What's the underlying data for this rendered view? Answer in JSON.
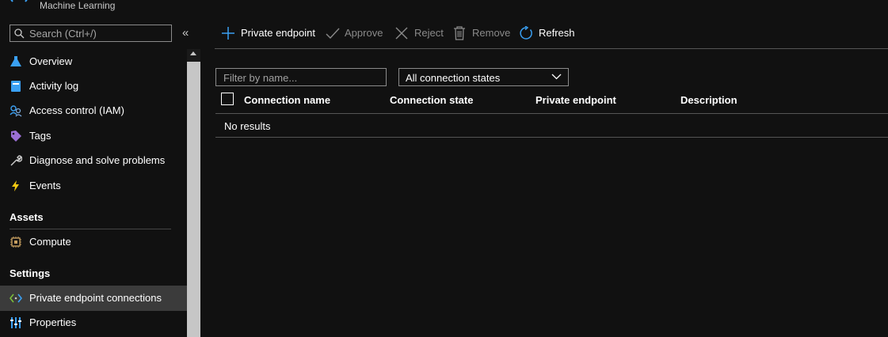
{
  "header": {
    "service_subtitle": "Machine Learning"
  },
  "search": {
    "placeholder": "Search (Ctrl+/)"
  },
  "sidebar": {
    "collapse_glyph": "«",
    "items": [
      {
        "label": "Overview",
        "icon": "overview-icon"
      },
      {
        "label": "Activity log",
        "icon": "activity-log-icon"
      },
      {
        "label": "Access control (IAM)",
        "icon": "iam-icon"
      },
      {
        "label": "Tags",
        "icon": "tag-icon"
      },
      {
        "label": "Diagnose and solve problems",
        "icon": "wrench-icon"
      },
      {
        "label": "Events",
        "icon": "lightning-icon"
      }
    ],
    "sections": [
      {
        "title": "Assets",
        "items": [
          {
            "label": "Compute",
            "icon": "compute-chip-icon"
          }
        ]
      },
      {
        "title": "Settings",
        "items": [
          {
            "label": "Private endpoint connections",
            "icon": "private-endpoint-icon",
            "active": true
          },
          {
            "label": "Properties",
            "icon": "properties-icon"
          }
        ]
      }
    ]
  },
  "toolbar": {
    "private_endpoint": "Private endpoint",
    "approve": "Approve",
    "reject": "Reject",
    "remove": "Remove",
    "refresh": "Refresh"
  },
  "filters": {
    "name_placeholder": "Filter by name...",
    "state_selected": "All connection states"
  },
  "table": {
    "columns": [
      "Connection name",
      "Connection state",
      "Private endpoint",
      "Description"
    ],
    "empty_text": "No results"
  },
  "colors": {
    "background": "#111111",
    "accent_blue": "#3aa0f3",
    "disabled_text": "#8a8a8a",
    "active_row": "#3b3b3b"
  }
}
